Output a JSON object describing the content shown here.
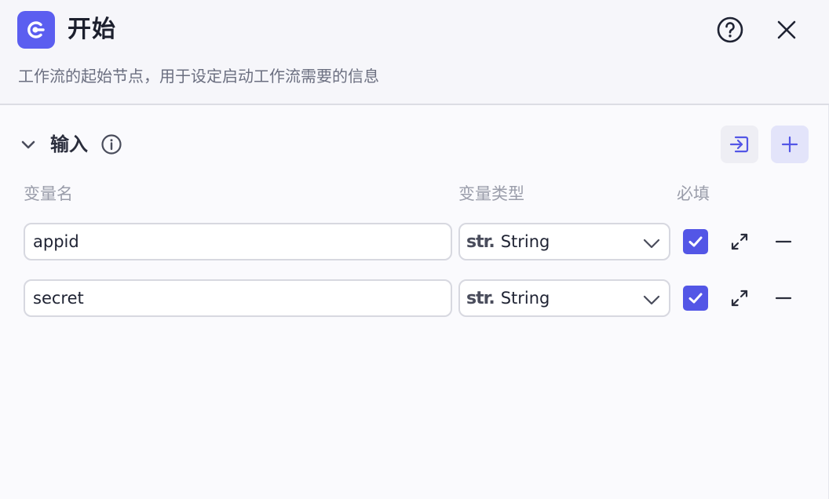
{
  "header": {
    "title": "开始",
    "subtitle": "工作流的起始节点，用于设定启动工作流需要的信息"
  },
  "section": {
    "title": "输入"
  },
  "columns": {
    "name": "变量名",
    "type": "变量类型",
    "required": "必填"
  },
  "rows": [
    {
      "name": "appid",
      "type_prefix": "str.",
      "type": "String",
      "required": true
    },
    {
      "name": "secret",
      "type_prefix": "str.",
      "type": "String",
      "required": true
    }
  ],
  "colors": {
    "accent": "#5b5ef0",
    "checkbox": "#5356e6",
    "border": "#d7d8e0"
  },
  "icons": {
    "logo": "start-node-icon",
    "help": "question-circle-icon",
    "close": "close-icon",
    "collapse": "chevron-down-icon",
    "info": "info-icon",
    "import": "import-icon",
    "add": "plus-icon",
    "expand": "expand-icon",
    "remove": "minus-icon"
  }
}
